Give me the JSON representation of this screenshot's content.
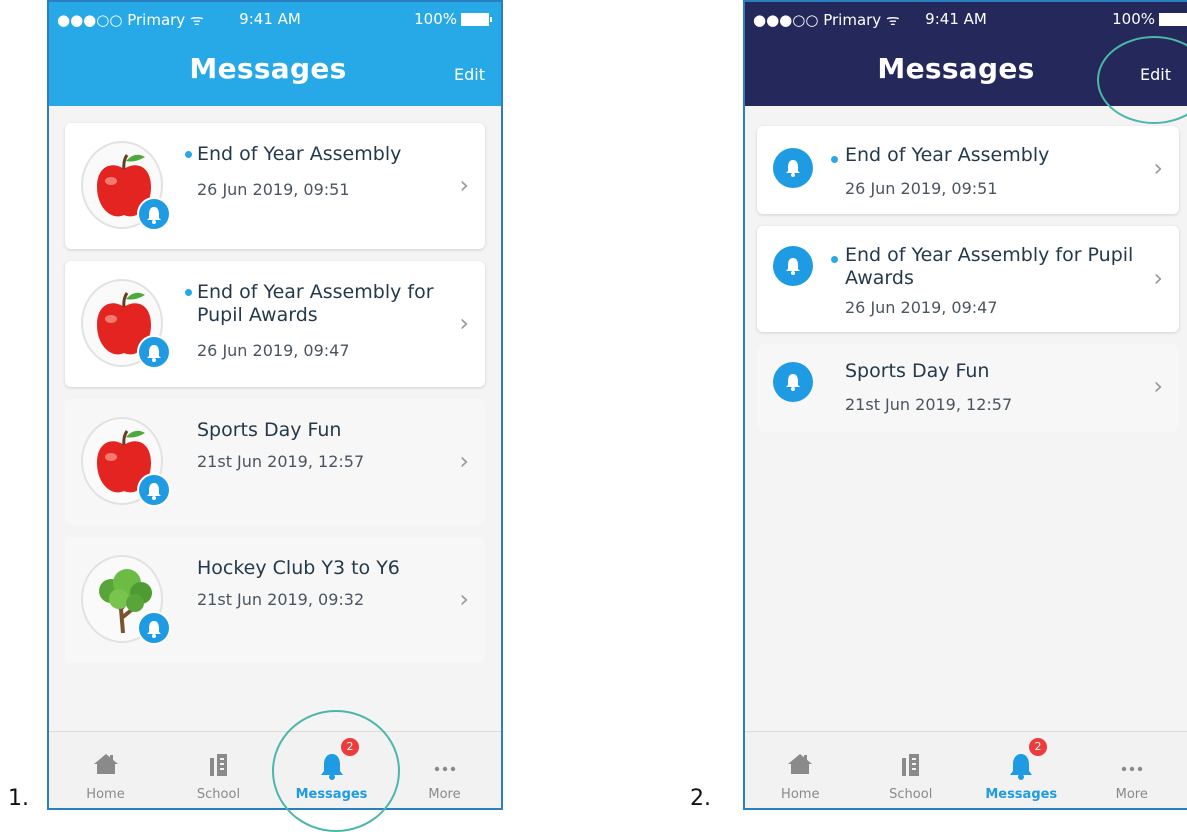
{
  "steps": [
    {
      "number": "1.",
      "status": {
        "carrier": "●●●○○ Primary ᯤ",
        "time": "9:41 AM",
        "battery": "100%"
      },
      "header": {
        "title": "Messages",
        "edit": "Edit",
        "color": "#27a9e7"
      },
      "messages": [
        {
          "title": "End of Year Assembly",
          "date": "26 Jun 2019, 09:51",
          "unread": true,
          "avatar": "apple-icon"
        },
        {
          "title": "End of Year Assembly for Pupil Awards",
          "date": "26 Jun 2019, 09:47",
          "unread": true,
          "avatar": "apple-icon"
        },
        {
          "title": "Sports Day Fun",
          "date": "21st Jun 2019, 12:57",
          "unread": false,
          "avatar": "apple-icon"
        },
        {
          "title": "Hockey Club Y3 to Y6",
          "date": "21st Jun 2019, 09:32",
          "unread": false,
          "avatar": "tree-icon"
        }
      ],
      "tabs": [
        {
          "label": "Home",
          "icon": "home-icon"
        },
        {
          "label": "School",
          "icon": "school-icon"
        },
        {
          "label": "Messages",
          "icon": "bell-icon",
          "badge": "2",
          "active": true
        },
        {
          "label": "More",
          "icon": "more-icon"
        }
      ]
    },
    {
      "number": "2.",
      "status": {
        "carrier": "●●●○○ Primary ᯤ",
        "time": "9:41 AM",
        "battery": "100%"
      },
      "header": {
        "title": "Messages",
        "edit": "Edit",
        "color": "#25285a"
      },
      "messages": [
        {
          "title": "End of Year Assembly",
          "date": "26 Jun 2019, 09:51",
          "unread": true
        },
        {
          "title": "End of Year Assembly for Pupil Awards",
          "date": "26 Jun 2019, 09:47",
          "unread": true
        },
        {
          "title": "Sports Day Fun",
          "date": "21st Jun 2019, 12:57",
          "unread": false
        }
      ],
      "tabs": [
        {
          "label": "Home",
          "icon": "home-icon"
        },
        {
          "label": "School",
          "icon": "school-icon"
        },
        {
          "label": "Messages",
          "icon": "bell-icon",
          "badge": "2",
          "active": true
        },
        {
          "label": "More",
          "icon": "more-icon"
        }
      ]
    }
  ],
  "highlight_color": "#4cb7a8"
}
